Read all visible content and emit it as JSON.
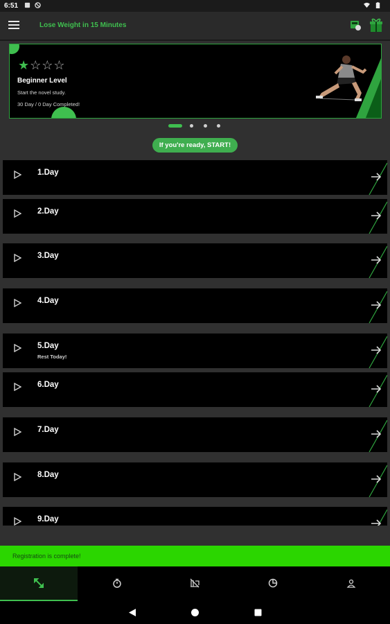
{
  "status_bar": {
    "time": "6:51"
  },
  "app_bar": {
    "title": "Lose Weight in 15 Minutes",
    "menu_icon": "menu-icon",
    "actions": [
      "timer-icon",
      "gift-icon"
    ]
  },
  "hero": {
    "rating": 1,
    "rating_max": 4,
    "level_title": "Beginner Level",
    "subtitle": "Start the novel study.",
    "progress_text": "30 Day / 0 Day Completed!"
  },
  "carousel": {
    "pages": 4,
    "active": 0
  },
  "start_button": {
    "label": "If you're ready, START!"
  },
  "days": [
    {
      "label": "1.Day",
      "note": ""
    },
    {
      "label": "2.Day",
      "note": ""
    },
    {
      "label": "3.Day",
      "note": ""
    },
    {
      "label": "4.Day",
      "note": ""
    },
    {
      "label": "5.Day",
      "note": "Rest Today!"
    },
    {
      "label": "6.Day",
      "note": ""
    },
    {
      "label": "7.Day",
      "note": ""
    },
    {
      "label": "8.Day",
      "note": ""
    },
    {
      "label": "9.Day",
      "note": ""
    }
  ],
  "toast": {
    "text": "Registration is complete!"
  },
  "bottom_nav": {
    "items": [
      "workout-icon",
      "timer-icon",
      "no-meal-icon",
      "pie-chart-icon",
      "profile-icon"
    ],
    "active": 0
  },
  "colors": {
    "accent": "#3fbf4f",
    "toast": "#2bd600",
    "card": "#000000",
    "background": "#303030"
  }
}
